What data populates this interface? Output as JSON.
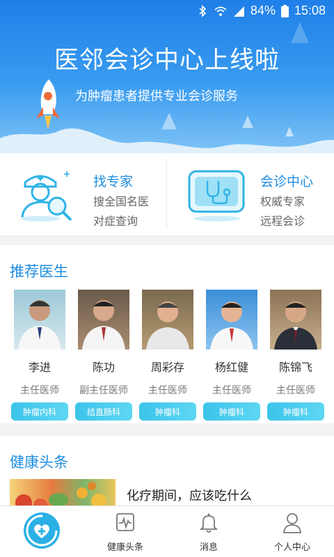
{
  "status_bar": {
    "battery": "84%",
    "time": "15:08"
  },
  "banner": {
    "title": "医邻会诊中心上线啦",
    "subtitle": "为肿瘤患者提供专业会诊服务"
  },
  "quick_entries": [
    {
      "title": "找专家",
      "line1": "搜全国名医",
      "line2": "对症查询"
    },
    {
      "title": "会诊中心",
      "line1": "权威专家",
      "line2": "远程会诊"
    }
  ],
  "recommend": {
    "title": "推荐医生",
    "doctors": [
      {
        "name": "李进",
        "title": "主任医师",
        "dept": "肿瘤内科"
      },
      {
        "name": "陈功",
        "title": "副主任医师",
        "dept": "结直肠科"
      },
      {
        "name": "周彩存",
        "title": "主任医师",
        "dept": "肿瘤科"
      },
      {
        "name": "杨红健",
        "title": "主任医师",
        "dept": "肿瘤科"
      },
      {
        "name": "陈锦飞",
        "title": "主任医师",
        "dept": "肿瘤科"
      }
    ]
  },
  "news": {
    "title": "健康头条",
    "items": [
      {
        "headline": "化疗期间，应该吃什么"
      }
    ]
  },
  "bottom_nav": [
    {
      "label": "",
      "icon": "home-heart-icon"
    },
    {
      "label": "健康头条",
      "icon": "pulse-monitor-icon"
    },
    {
      "label": "消息",
      "icon": "bell-icon"
    },
    {
      "label": "个人中心",
      "icon": "person-icon"
    }
  ],
  "colors": {
    "accent": "#1f8ee0",
    "tag": "#3bc4ea",
    "banner": "#2b8df0"
  }
}
